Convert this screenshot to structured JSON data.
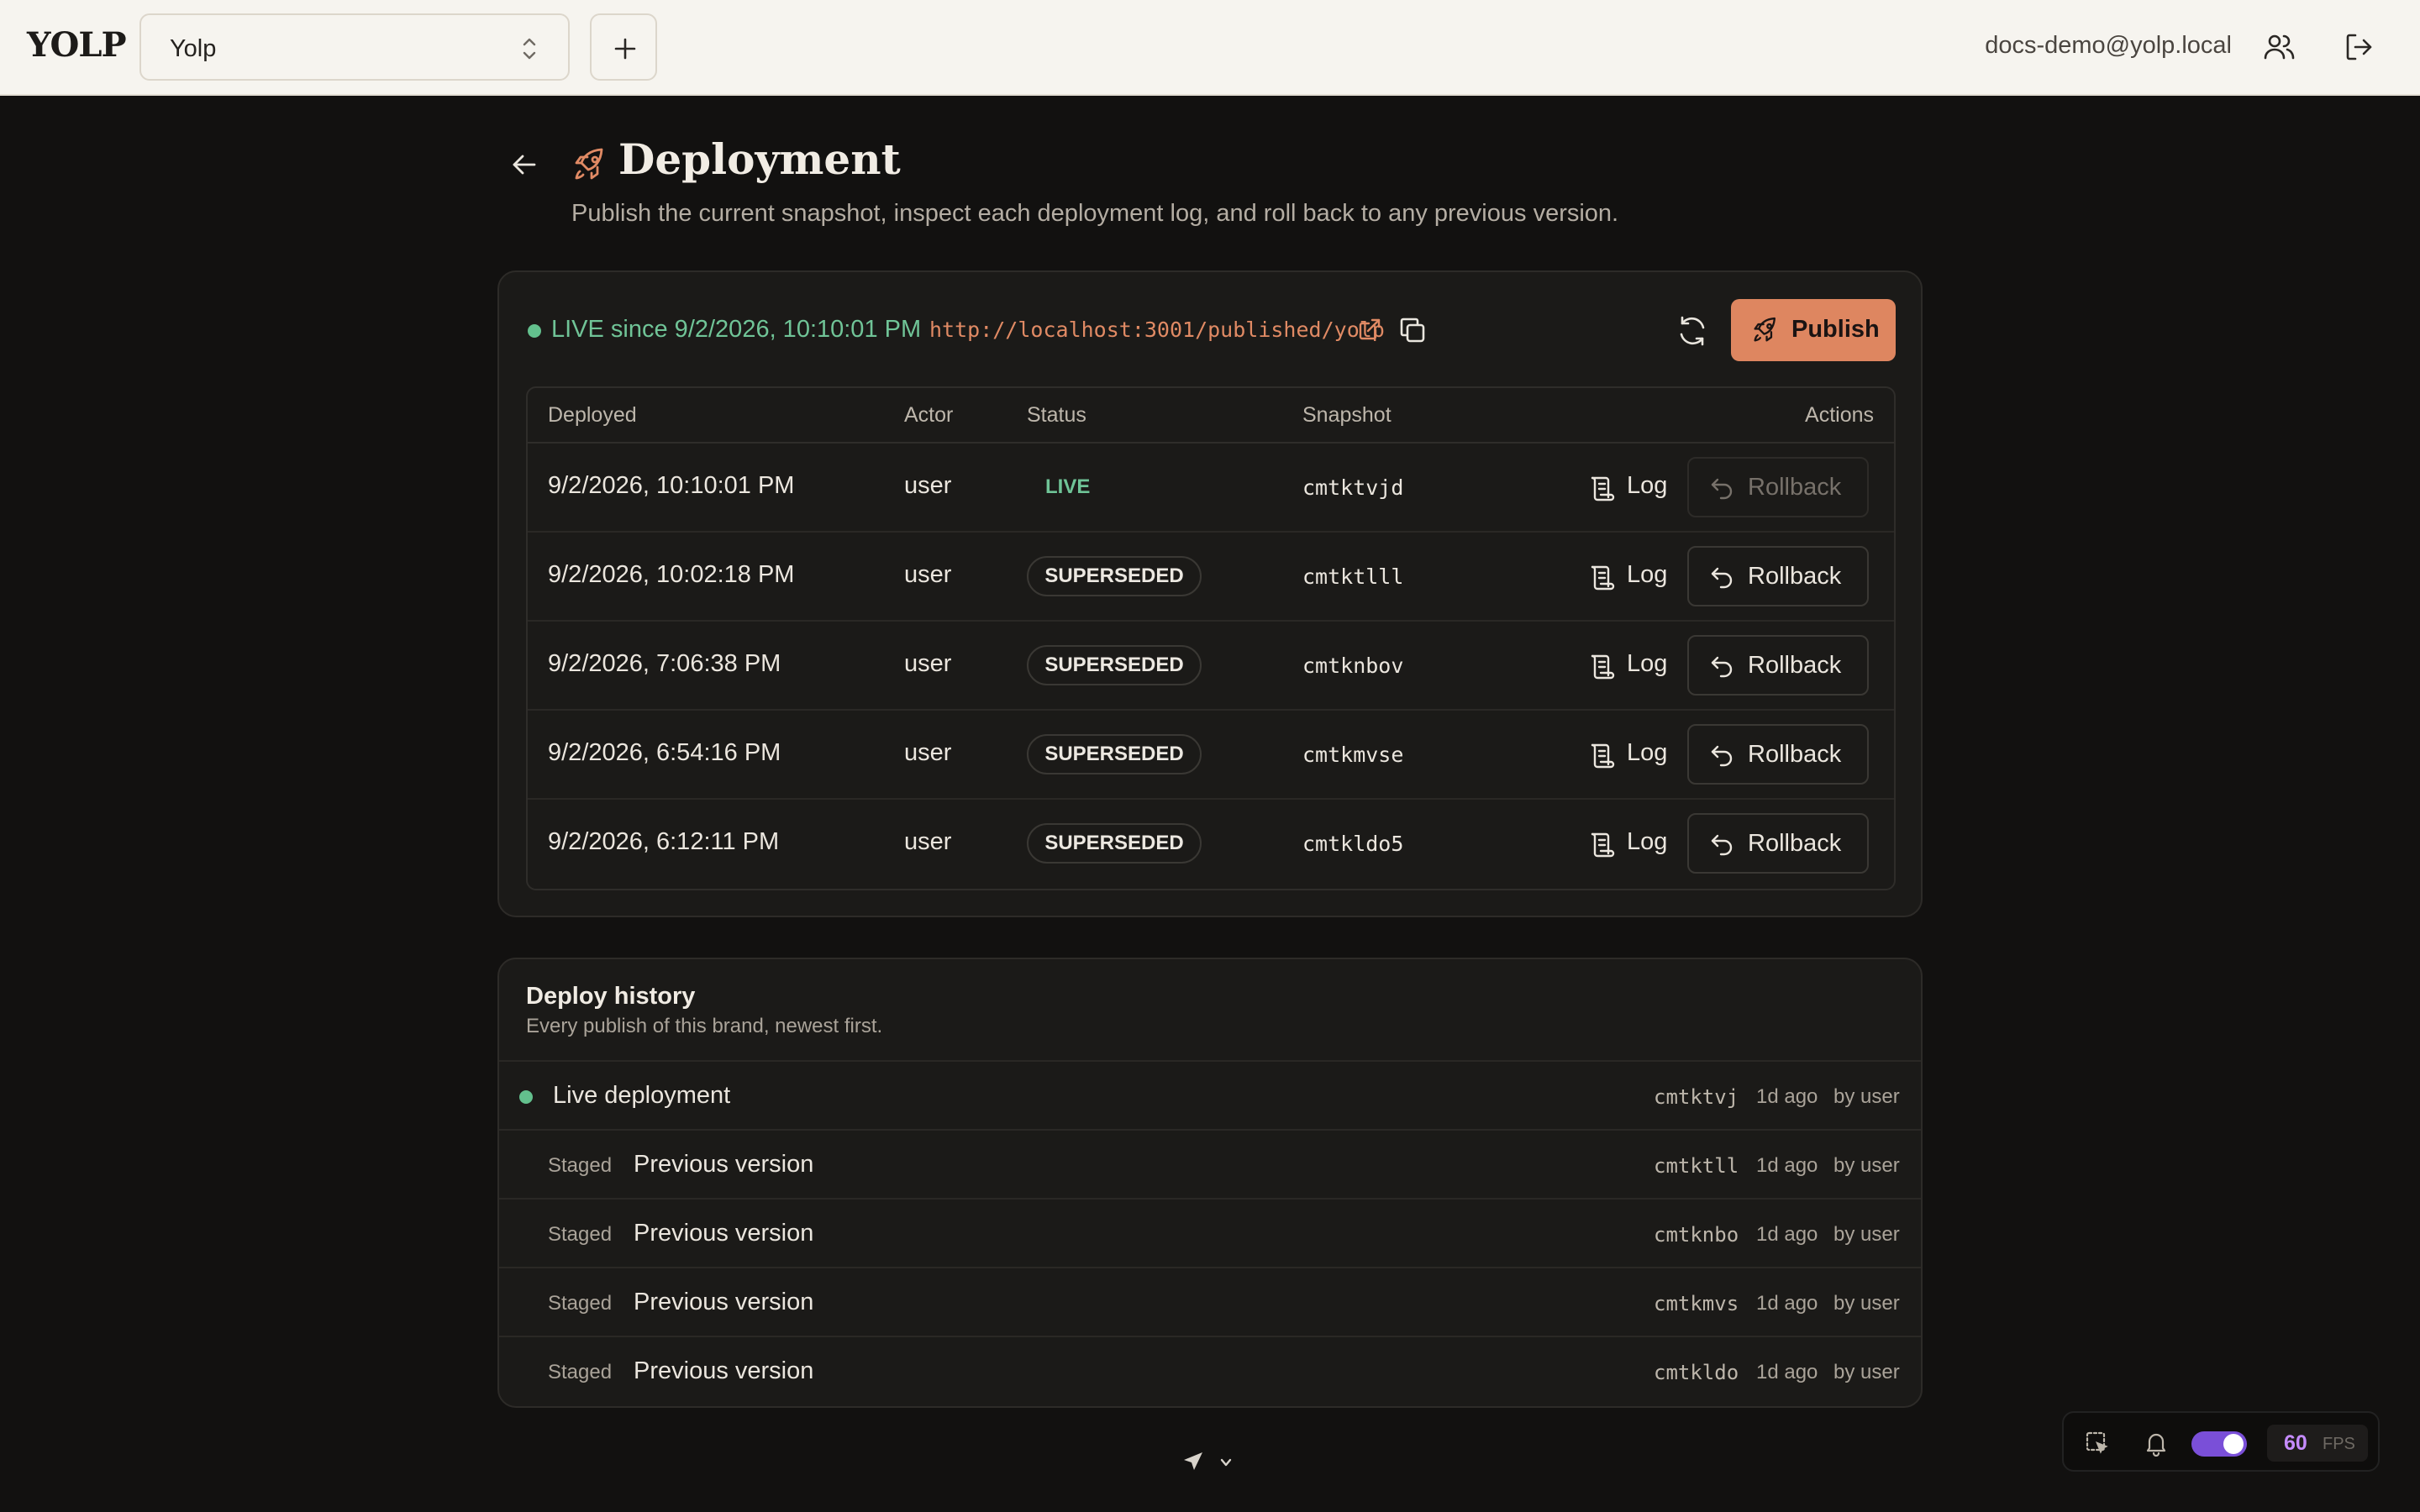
{
  "topbar": {
    "logo": "YOLP",
    "brand_select_value": "Yolp",
    "user_email": "docs-demo@yolp.local"
  },
  "header": {
    "title": "Deployment",
    "subtitle": "Publish the current snapshot, inspect each deployment log, and roll back to any previous version."
  },
  "deploy": {
    "live_status": "LIVE since 9/2/2026, 10:10:01 PM",
    "live_url": "http://localhost:3001/published/yolp",
    "publish_label": "Publish",
    "columns": [
      "Deployed",
      "Actor",
      "Status",
      "Snapshot",
      "Actions"
    ],
    "log_label": "Log",
    "rollback_label": "Rollback",
    "rows": [
      {
        "deployed": "9/2/2026, 10:10:01 PM",
        "actor": "user",
        "status": "LIVE",
        "snapshot": "cmtktvjd"
      },
      {
        "deployed": "9/2/2026, 10:02:18 PM",
        "actor": "user",
        "status": "SUPERSEDED",
        "snapshot": "cmtktlll"
      },
      {
        "deployed": "9/2/2026, 7:06:38 PM",
        "actor": "user",
        "status": "SUPERSEDED",
        "snapshot": "cmtknbov"
      },
      {
        "deployed": "9/2/2026, 6:54:16 PM",
        "actor": "user",
        "status": "SUPERSEDED",
        "snapshot": "cmtkmvse"
      },
      {
        "deployed": "9/2/2026, 6:12:11 PM",
        "actor": "user",
        "status": "SUPERSEDED",
        "snapshot": "cmtkldo5"
      }
    ]
  },
  "history": {
    "title": "Deploy history",
    "subtitle": "Every publish of this brand, newest first.",
    "staged_label": "Staged",
    "items": [
      {
        "label": "Live deployment",
        "snapshot": "cmtktvj",
        "ago": "1d ago",
        "by": "by user"
      },
      {
        "label": "Previous version",
        "snapshot": "cmtktll",
        "ago": "1d ago",
        "by": "by user"
      },
      {
        "label": "Previous version",
        "snapshot": "cmtknbo",
        "ago": "1d ago",
        "by": "by user"
      },
      {
        "label": "Previous version",
        "snapshot": "cmtkmvs",
        "ago": "1d ago",
        "by": "by user"
      },
      {
        "label": "Previous version",
        "snapshot": "cmtkldo",
        "ago": "1d ago",
        "by": "by user"
      }
    ]
  },
  "devbar": {
    "fps_value": "60",
    "fps_unit": "FPS",
    "toggle_on": true
  },
  "colors": {
    "accent": "#de8660",
    "live": "#63c08d",
    "toggle": "#7a4fd8"
  }
}
